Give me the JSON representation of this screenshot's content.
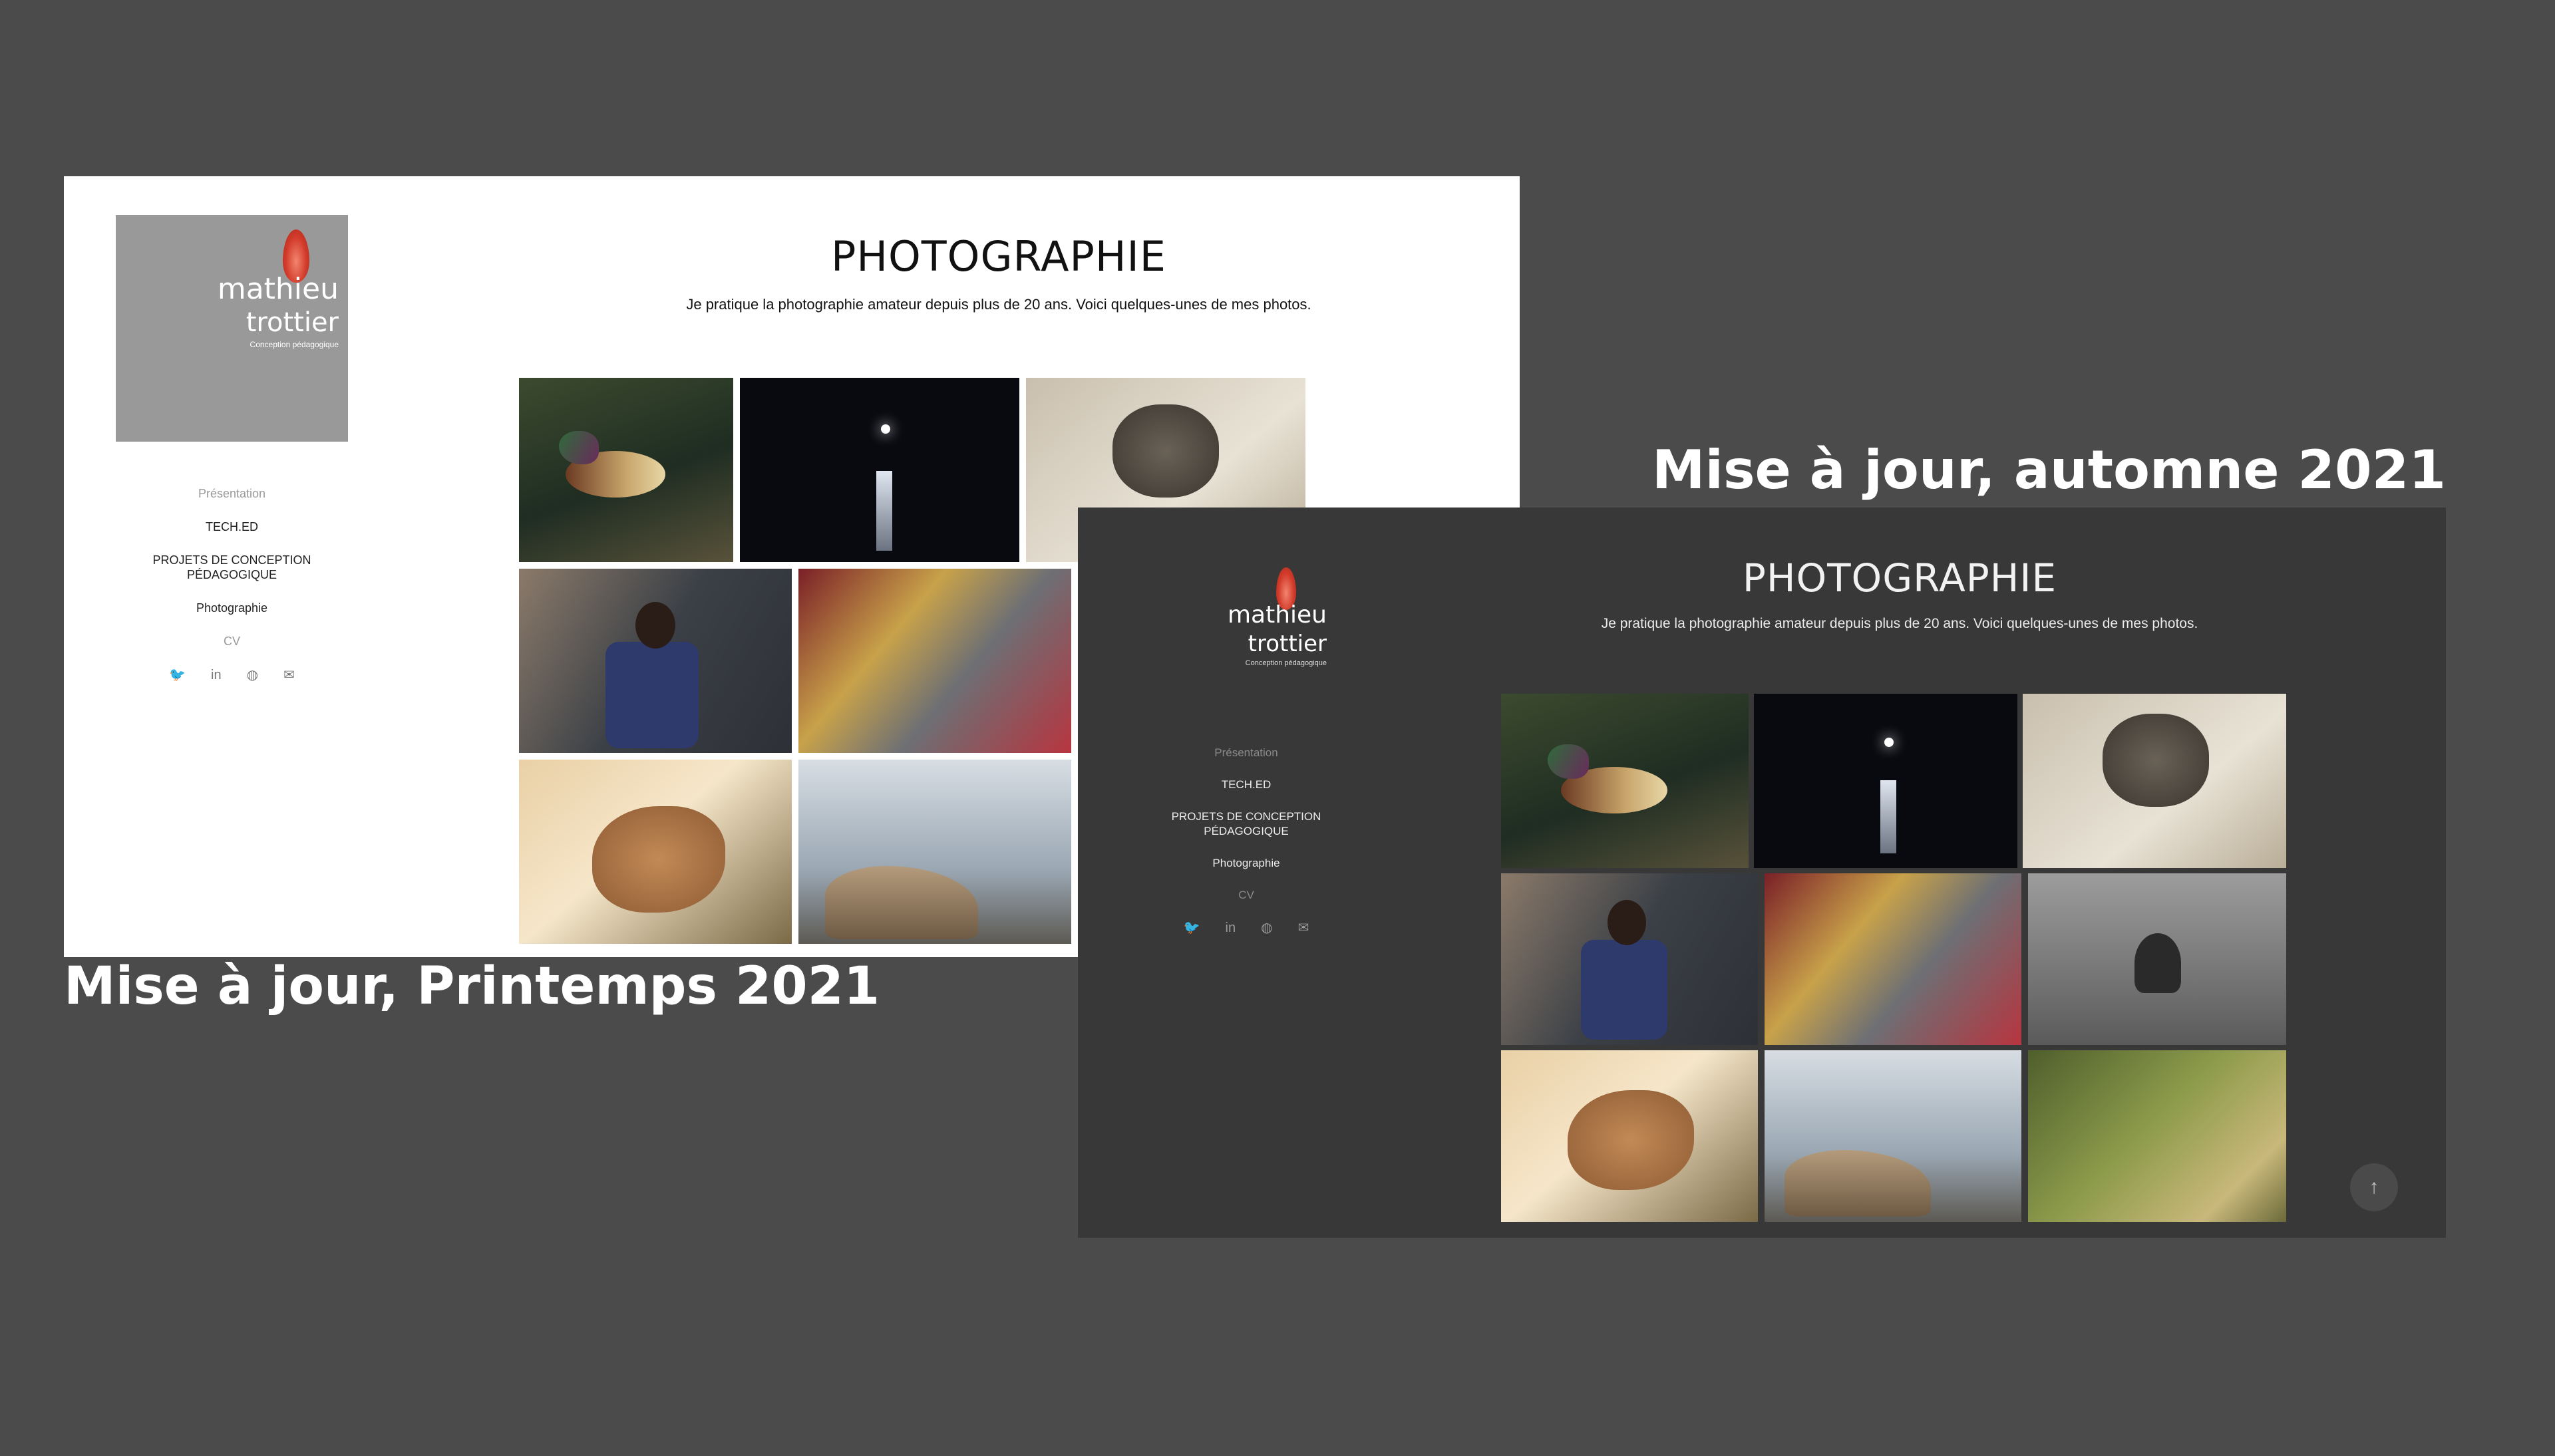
{
  "captions": {
    "spring": "Mise à jour, Printemps 2021",
    "fall": "Mise à jour, automne 2021"
  },
  "site": {
    "logo": {
      "name_line1": "mathieu",
      "name_line2": "trottier",
      "tagline": "Conception pédagogique"
    },
    "nav": [
      {
        "label": "Présentation"
      },
      {
        "label": "TECH.ED"
      },
      {
        "label": "PROJETS DE CONCEPTION PÉDAGOGIQUE"
      },
      {
        "label": "Photographie"
      },
      {
        "label": "CV"
      }
    ],
    "social_icons": [
      "twitter-icon",
      "linkedin-icon",
      "evernote-icon",
      "mail-icon"
    ],
    "page": {
      "title": "PHOTOGRAPHIE",
      "intro": "Je pratique la photographie amateur depuis plus de 20 ans. Voici quelques-unes de mes photos."
    },
    "gallery_subjects": [
      "duck",
      "moon-over-lake",
      "rocks-heart",
      "crowd-selfie",
      "love-locks",
      "child-in-water",
      "chicken",
      "sunset-rocks",
      "moss-bark"
    ]
  },
  "colors": {
    "background": "#4b4b4b",
    "spring_site_bg": "#ffffff",
    "fall_site_bg": "#383838",
    "logo_accent": "#d23a2a"
  }
}
